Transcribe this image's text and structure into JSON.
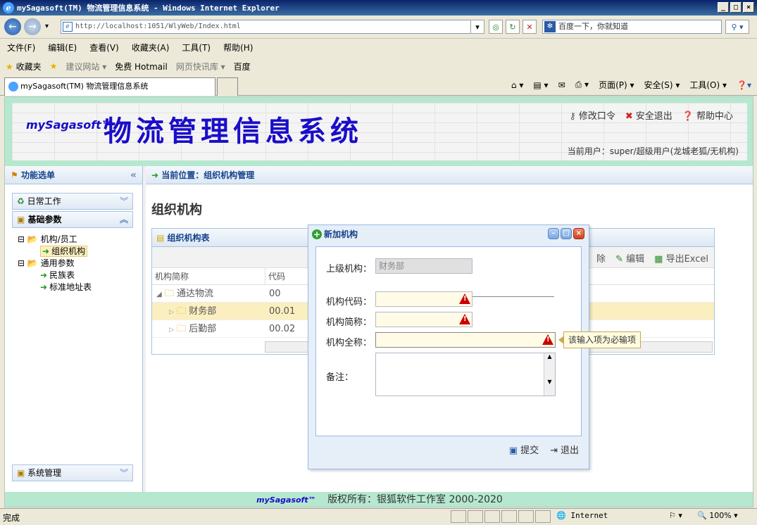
{
  "window": {
    "title": "mySagasoft(TM) 物流管理信息系统 - Windows Internet Explorer",
    "address": "http://localhost:1051/WlyWeb/Index.html",
    "search_placeholder": "百度一下，你就知道"
  },
  "ie_menu": [
    "文件(F)",
    "编辑(E)",
    "查看(V)",
    "收藏夹(A)",
    "工具(T)",
    "帮助(H)"
  ],
  "favorites": {
    "label": "收藏夹",
    "items": [
      "建议网站 ▾",
      "免费 Hotmail",
      "网页快讯库 ▾",
      "百度"
    ]
  },
  "tab": {
    "title": "mySagasoft(TM) 物流管理信息系统"
  },
  "ie_commands": [
    "页面(P) ▾",
    "安全(S) ▾",
    "工具(O) ▾"
  ],
  "header": {
    "logo": "mySagasoft™",
    "system_name": "物流管理信息系统",
    "links": [
      "修改口令",
      "安全退出",
      "帮助中心"
    ],
    "current_user": "当前用户：super/超级用户(龙城老狐/无机构)"
  },
  "sidebar": {
    "title": "功能选单",
    "sections": [
      "日常工作",
      "基础参数",
      "系统管理"
    ],
    "tree": {
      "group1": "机构/员工",
      "group1_item": "组织机构",
      "group2": "通用参数",
      "group2_items": [
        "民族表",
        "标准地址表"
      ]
    }
  },
  "main": {
    "location": "当前位置：组织机构管理",
    "page_title": "组织机构",
    "grid": {
      "title": "组织机构表",
      "tools": [
        "除",
        "编辑",
        "导出Excel"
      ],
      "columns": [
        "机构简称",
        "代码"
      ],
      "rows": [
        {
          "name": "通达物流",
          "code": "00"
        },
        {
          "name": "财务部",
          "code": "00.01"
        },
        {
          "name": "后勤部",
          "code": "00.02"
        }
      ]
    }
  },
  "dialog": {
    "title": "新加机构",
    "labels": {
      "parent": "上级机构：",
      "code": "机构代码：",
      "short_name": "机构简称：",
      "full_name": "机构全称：",
      "remark": "备注："
    },
    "parent_value": "财务部",
    "tooltip": "该输入项为必输项",
    "submit": "提交",
    "exit": "退出"
  },
  "footer": {
    "logo": "mySagasoft™",
    "copyright": "版权所有：银狐软件工作室 2000-2020"
  },
  "status": {
    "text": "完成",
    "zone": "Internet",
    "zoom": "100%"
  },
  "colors": {
    "title_blue": "#1a0dc8",
    "header_green": "#b6e8d0",
    "panel_blue": "#15428b",
    "highlight": "#fbefc0"
  }
}
